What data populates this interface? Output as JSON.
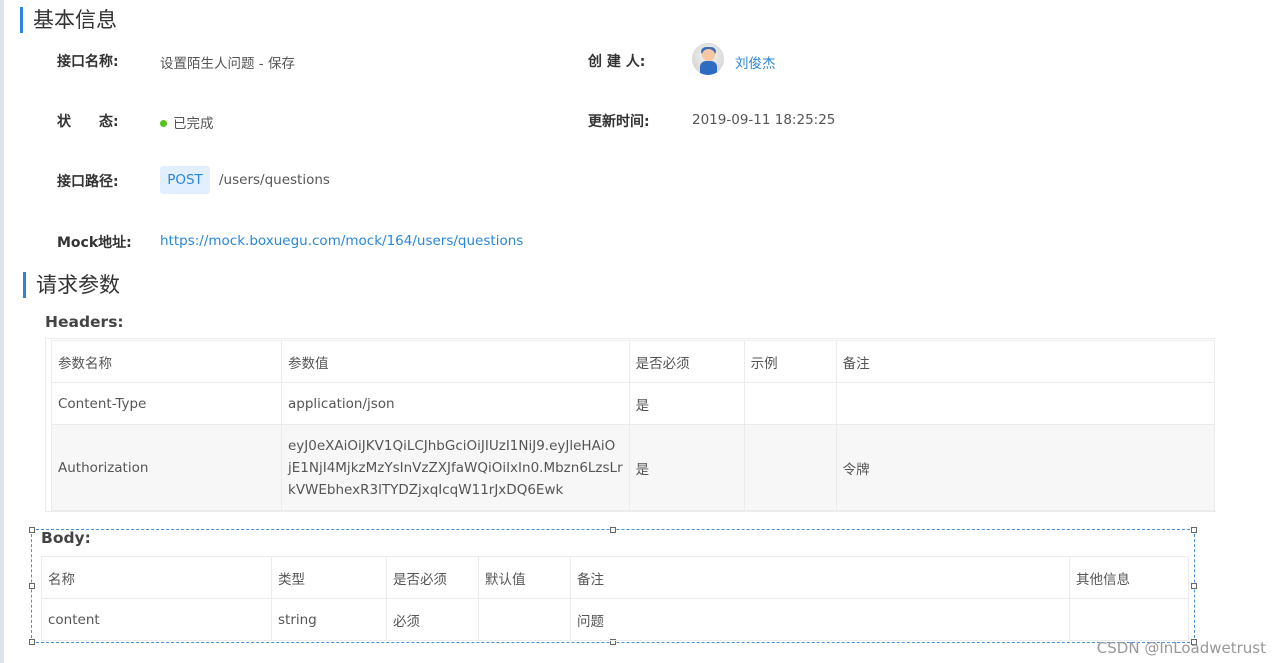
{
  "basic_info": {
    "title": "基本信息",
    "interface_name_label": "接口名称:",
    "interface_name": "设置陌生人问题 - 保存",
    "creator_label": "创 建 人:",
    "creator": "刘俊杰",
    "status_label": "状　　态:",
    "status": "已完成",
    "status_color": "#52c41a",
    "updated_label": "更新时间:",
    "updated": "2019-09-11 18:25:25",
    "path_label": "接口路径:",
    "method": "POST",
    "path": "/users/questions",
    "mock_label": "Mock地址:",
    "mock_url": "https://mock.boxuegu.com/mock/164/users/questions"
  },
  "request_params": {
    "title": "请求参数",
    "headers_label": "Headers:",
    "headers_columns": [
      "参数名称",
      "参数值",
      "是否必须",
      "示例",
      "备注"
    ],
    "headers_rows": [
      {
        "name": "Content-Type",
        "value": "application/json",
        "required": "是",
        "example": "",
        "note": ""
      },
      {
        "name": "Authorization",
        "value_lines": [
          "eyJ0eXAiOiJKV1QiLCJhbGciOiJIUzI1NiJ9.eyJleHAiO",
          "jE1NjI4MjkzMzYsInVzZXJfaWQiOiIxIn0.Mbzn6LzsLr",
          "kVWEbhexR3lTYDZjxqIcqW11rJxDQ6Ewk"
        ],
        "required": "是",
        "example": "",
        "note": "令牌"
      }
    ],
    "body_label": "Body:",
    "body_columns": [
      "名称",
      "类型",
      "是否必须",
      "默认值",
      "备注",
      "其他信息"
    ],
    "body_rows": [
      {
        "name": "content",
        "type": "string",
        "required": "必须",
        "default": "",
        "note": "问题",
        "other": ""
      }
    ]
  },
  "watermark": "CSDN @InLoadwetrust",
  "accent_color": "#2a86d9"
}
